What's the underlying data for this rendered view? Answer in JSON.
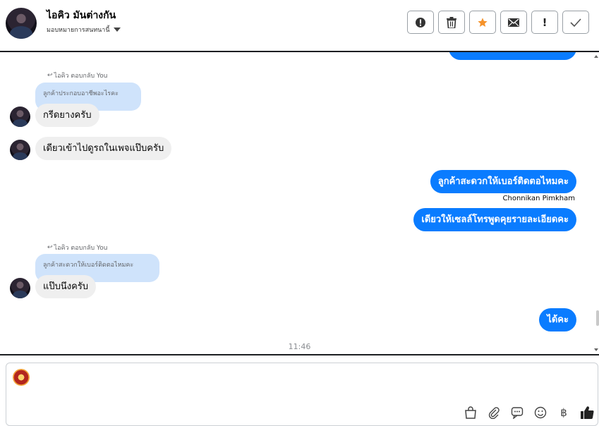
{
  "header": {
    "contact_name": "ไอคิว มันต่างกัน",
    "assign_label": "มอบหมายการสนทนานี้",
    "actions": [
      {
        "name": "spam-button",
        "icon": "alert-circle-icon"
      },
      {
        "name": "delete-button",
        "icon": "trash-icon"
      },
      {
        "name": "star-button",
        "icon": "star-icon",
        "color": "#f5922a"
      },
      {
        "name": "mark-unread-button",
        "icon": "envelope-icon"
      },
      {
        "name": "follow-up-button",
        "icon": "exclamation-icon",
        "glyph": "!"
      },
      {
        "name": "done-button",
        "icon": "checkmark-icon"
      }
    ]
  },
  "messages": {
    "reply1": {
      "meta": "ไอคิว ตอบกลับ You",
      "quote": "ลูกค้าประกอบอาชีพอะไรคะ",
      "text": "กรีดยางครับ"
    },
    "msg2": "เดียวเข้าไปดูรถในเพจแป๊บครับ",
    "out1": "ลูกค้าสะดวกให้เบอร์ติดตอไหมคะ",
    "sender": "Chonnikan Pimkham",
    "out2": "เดียวให้เซลล์โทรพูดคุยรายละเอียดคะ",
    "reply2": {
      "meta": "ไอคิว ตอบกลับ You",
      "quote": "ลูกค้าสะดวกให้เบอร์ติดตอไหมคะ",
      "text": "แป๊บนึงครับ"
    },
    "out3": "ได้คะ",
    "timestamp": "11:46"
  },
  "composer": {
    "tools": [
      "shopping-bag-icon",
      "paperclip-icon",
      "chat-bubble-icon",
      "smiley-icon",
      "baht-icon",
      "thumbs-up-icon"
    ],
    "baht_glyph": "฿"
  },
  "colors": {
    "accent": "#0a7cff",
    "incoming": "#efefef",
    "quote": "#cfe3fb",
    "star": "#f5922a"
  }
}
